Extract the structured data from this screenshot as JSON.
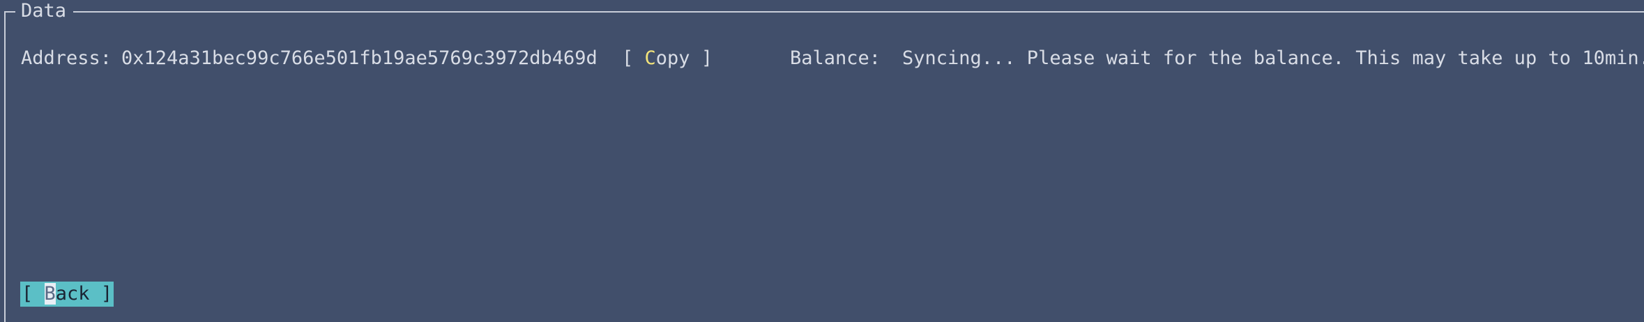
{
  "panel": {
    "title": "Data"
  },
  "address": {
    "label": "Address:",
    "value": "0x124a31bec99c766e501fb19ae5769c3972db469d"
  },
  "copy_button": {
    "open": "[ ",
    "hotkey": "C",
    "rest": "opy",
    "close": " ]"
  },
  "balance": {
    "label": "Balance:",
    "value": "Syncing... Please wait for the balance. This may take up to 10min."
  },
  "back_button": {
    "open": "[ ",
    "hotkey": "B",
    "rest": "ack",
    "close": " ]"
  },
  "colors": {
    "background": "#414f6b",
    "text": "#d9dde6",
    "hotkey": "#f3e47a",
    "focused_button_bg": "#5bbfc6",
    "focused_button_fg": "#1b2433"
  }
}
